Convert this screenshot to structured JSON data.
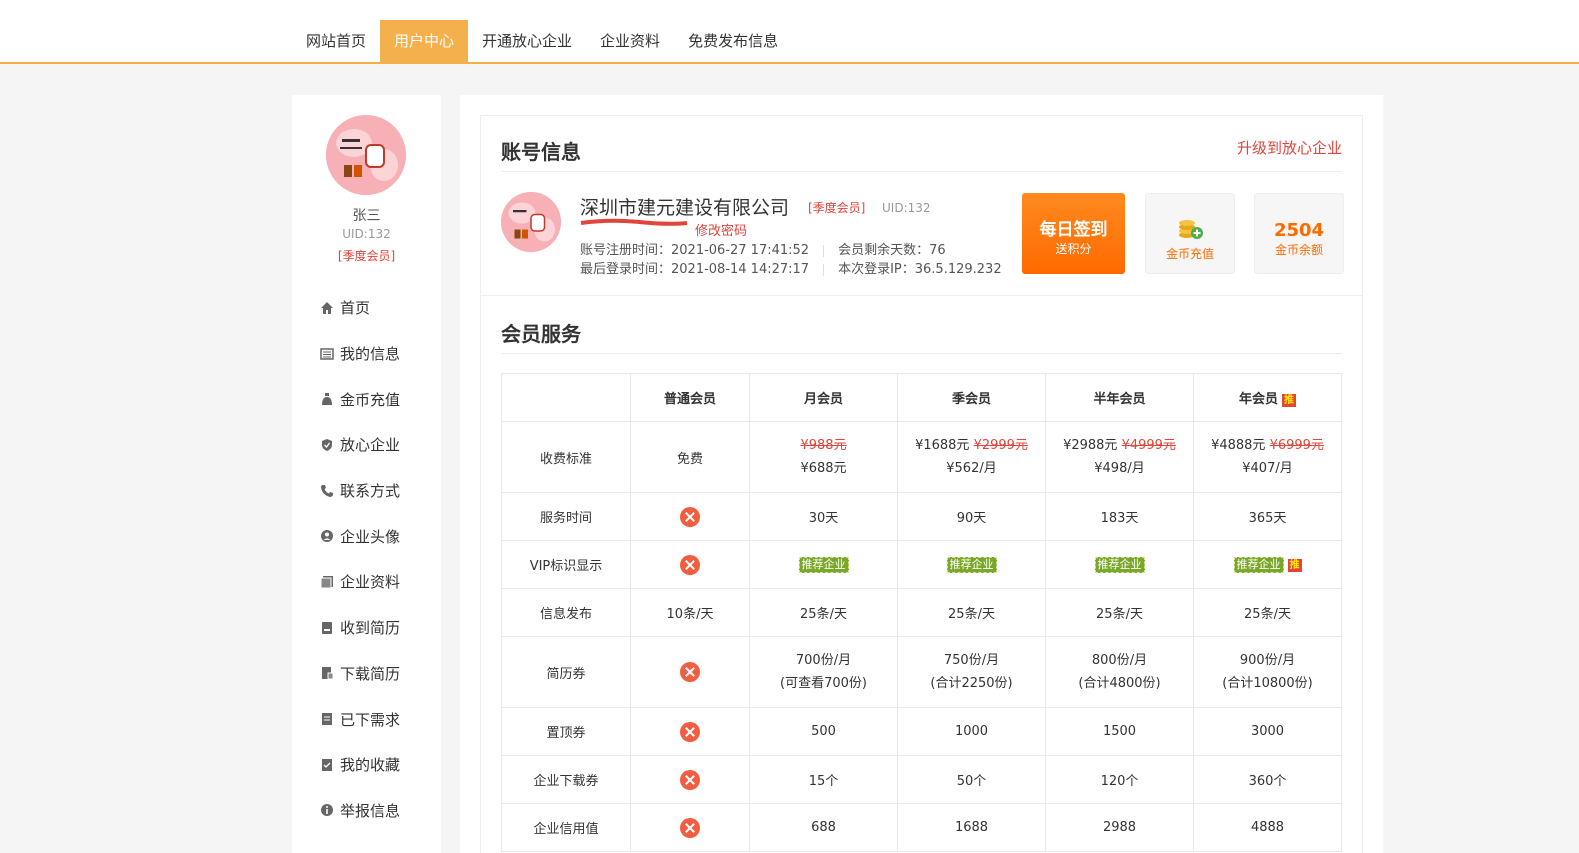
{
  "topnav": [
    {
      "label": "网站首页",
      "active": false
    },
    {
      "label": "用户中心",
      "active": true
    },
    {
      "label": "开通放心企业",
      "active": false
    },
    {
      "label": "企业资料",
      "active": false
    },
    {
      "label": "免费发布信息",
      "active": false
    }
  ],
  "sidebar": {
    "name": "张三",
    "uid": "UID:132",
    "level": "[季度会员]",
    "menu": [
      {
        "label": "首页",
        "icon": "home-icon"
      },
      {
        "label": "我的信息",
        "icon": "list-icon"
      },
      {
        "label": "金币充值",
        "icon": "coin-bag-icon"
      },
      {
        "label": "放心企业",
        "icon": "shield-icon"
      },
      {
        "label": "联系方式",
        "icon": "phone-icon"
      },
      {
        "label": "企业头像",
        "icon": "user-circle-icon"
      },
      {
        "label": "企业资料",
        "icon": "document-icon"
      },
      {
        "label": "收到简历",
        "icon": "inbox-icon"
      },
      {
        "label": "下载简历",
        "icon": "download-doc-icon"
      },
      {
        "label": "已下需求",
        "icon": "file-icon"
      },
      {
        "label": "我的收藏",
        "icon": "bookmark-icon"
      },
      {
        "label": "举报信息",
        "icon": "info-icon"
      }
    ]
  },
  "account": {
    "title": "账号信息",
    "upgrade": "升级到放心企业",
    "company": "深圳市建元建设有限公司",
    "level": "[季度会员]",
    "uid": "UID:132",
    "change_password": "修改密码",
    "reg_time": "账号注册时间：2021-06-27 17:41:52",
    "remaining": "会员剩余天数：76",
    "last_login": "最后登录时间：2021-08-14 14:27:17",
    "login_ip": "本次登录IP：36.5.129.232",
    "sign_title": "每日签到",
    "sign_sub": "送积分",
    "recharge": "金币充值",
    "balance_num": "2504",
    "balance_label": "金币余额"
  },
  "membership": {
    "title": "会员服务",
    "headers": [
      "",
      "普通会员",
      "月会员",
      "季会员",
      "半年会员",
      "年会员"
    ],
    "hot_tag": "推",
    "vip_badge": "推荐企业",
    "price": {
      "label": "收费标准",
      "free": "免费",
      "month_old": "¥988元",
      "month_new": "¥688元",
      "season_price": "¥1688元",
      "season_old": "¥2999元",
      "season_per": "¥562/月",
      "half_price": "¥2988元",
      "half_old": "¥4999元",
      "half_per": "¥498/月",
      "year_price": "¥4888元",
      "year_old": "¥6999元",
      "year_per": "¥407/月"
    },
    "rows": {
      "service_time": {
        "label": "服务时间",
        "vals": [
          "30天",
          "90天",
          "183天",
          "365天"
        ]
      },
      "vip_show": {
        "label": "VIP标识显示"
      },
      "publish": {
        "label": "信息发布",
        "normal": "10条/天",
        "vals": [
          "25条/天",
          "25条/天",
          "25条/天",
          "25条/天"
        ]
      },
      "resume": {
        "label": "简历券",
        "vals": [
          "700份/月",
          "750份/月",
          "800份/月",
          "900份/月"
        ],
        "subs": [
          "(可查看700份)",
          "(合计2250份)",
          "(合计4800份)",
          "(合计10800份)"
        ]
      },
      "top": {
        "label": "置顶券",
        "vals": [
          "500",
          "1000",
          "1500",
          "3000"
        ]
      },
      "download": {
        "label": "企业下载券",
        "vals": [
          "15个",
          "50个",
          "120个",
          "360个"
        ]
      },
      "credit": {
        "label": "企业信用值",
        "vals": [
          "688",
          "1688",
          "2988",
          "4888"
        ]
      }
    }
  }
}
